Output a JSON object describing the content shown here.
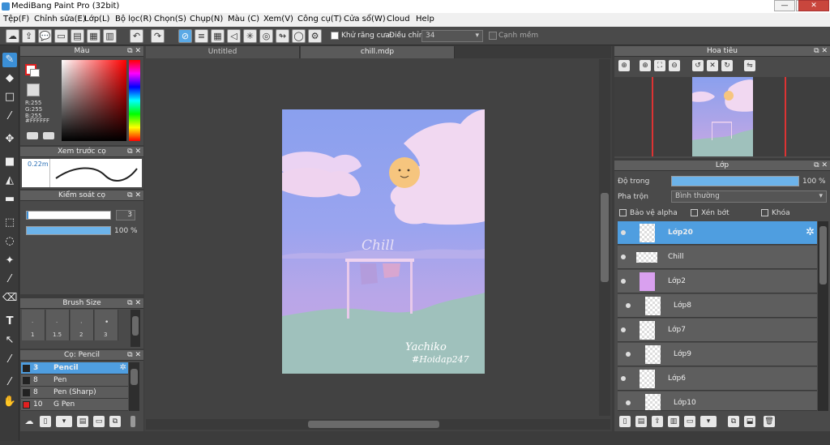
{
  "window": {
    "title": "MediBang Paint Pro (32bit)",
    "minimize": "—",
    "maximize": "❐",
    "close": "✕"
  },
  "menu": [
    "Tệp(F)",
    "Chỉnh sửa(E)",
    "Lớp(L)",
    "Bộ lọc(R)",
    "Chọn(S)",
    "Chụp(N)",
    "Màu (C)",
    "Xem(V)",
    "Công cụ(T)",
    "Cửa sổ(W)",
    "Cloud",
    "Help"
  ],
  "toolbar": {
    "antialias_label": "Khử răng cưa",
    "adjust_label": "Điều chỉnh",
    "adjust_value": "34",
    "edge_label": "Cạnh mềm"
  },
  "color_panel": {
    "title": "Màu",
    "r": "R:255",
    "g": "G:255",
    "b": "B:255",
    "hex": "#FFFFFF"
  },
  "brush_preview": {
    "title": "Xem trước cọ",
    "size": "0.22m"
  },
  "brush_control": {
    "title": "Kiểm soát cọ",
    "size_value": "3",
    "opacity_value": "100 %",
    "opacity": 100
  },
  "brush_size": {
    "title": "Brush Size",
    "sizes": [
      "1",
      "1.5",
      "2",
      "3"
    ]
  },
  "brush_list": {
    "title": "Cọ: Pencil",
    "items": [
      {
        "size": "3",
        "name": "Pencil",
        "color": "#222222"
      },
      {
        "size": "8",
        "name": "Pen",
        "color": "#222222"
      },
      {
        "size": "8",
        "name": "Pen (Sharp)",
        "color": "#222222"
      },
      {
        "size": "10",
        "name": "G Pen",
        "color": "#e02020"
      }
    ]
  },
  "tabs": [
    "Untitled",
    "chill.mdp"
  ],
  "artwork": {
    "chill_text": "Chill",
    "signature_line1": "Yachiko",
    "signature_line2": "#Hoidap247"
  },
  "navigator": {
    "title": "Hoa tiêu"
  },
  "layers": {
    "title": "Lớp",
    "opacity_label": "Độ trong",
    "opacity_value": "100 %",
    "opacity": 100,
    "blend_label": "Pha trộn",
    "blend_value": "Bình thường",
    "protect_alpha": "Bảo vệ alpha",
    "clipping": "Xén bớt",
    "lock": "Khóa",
    "items": [
      {
        "name": "Lớp20",
        "selected": true
      },
      {
        "name": "Chill"
      },
      {
        "name": "Lớp2"
      },
      {
        "name": "Lớp8"
      },
      {
        "name": "Lớp7"
      },
      {
        "name": "Lớp9"
      },
      {
        "name": "Lớp6"
      },
      {
        "name": "Lớp10"
      }
    ]
  }
}
